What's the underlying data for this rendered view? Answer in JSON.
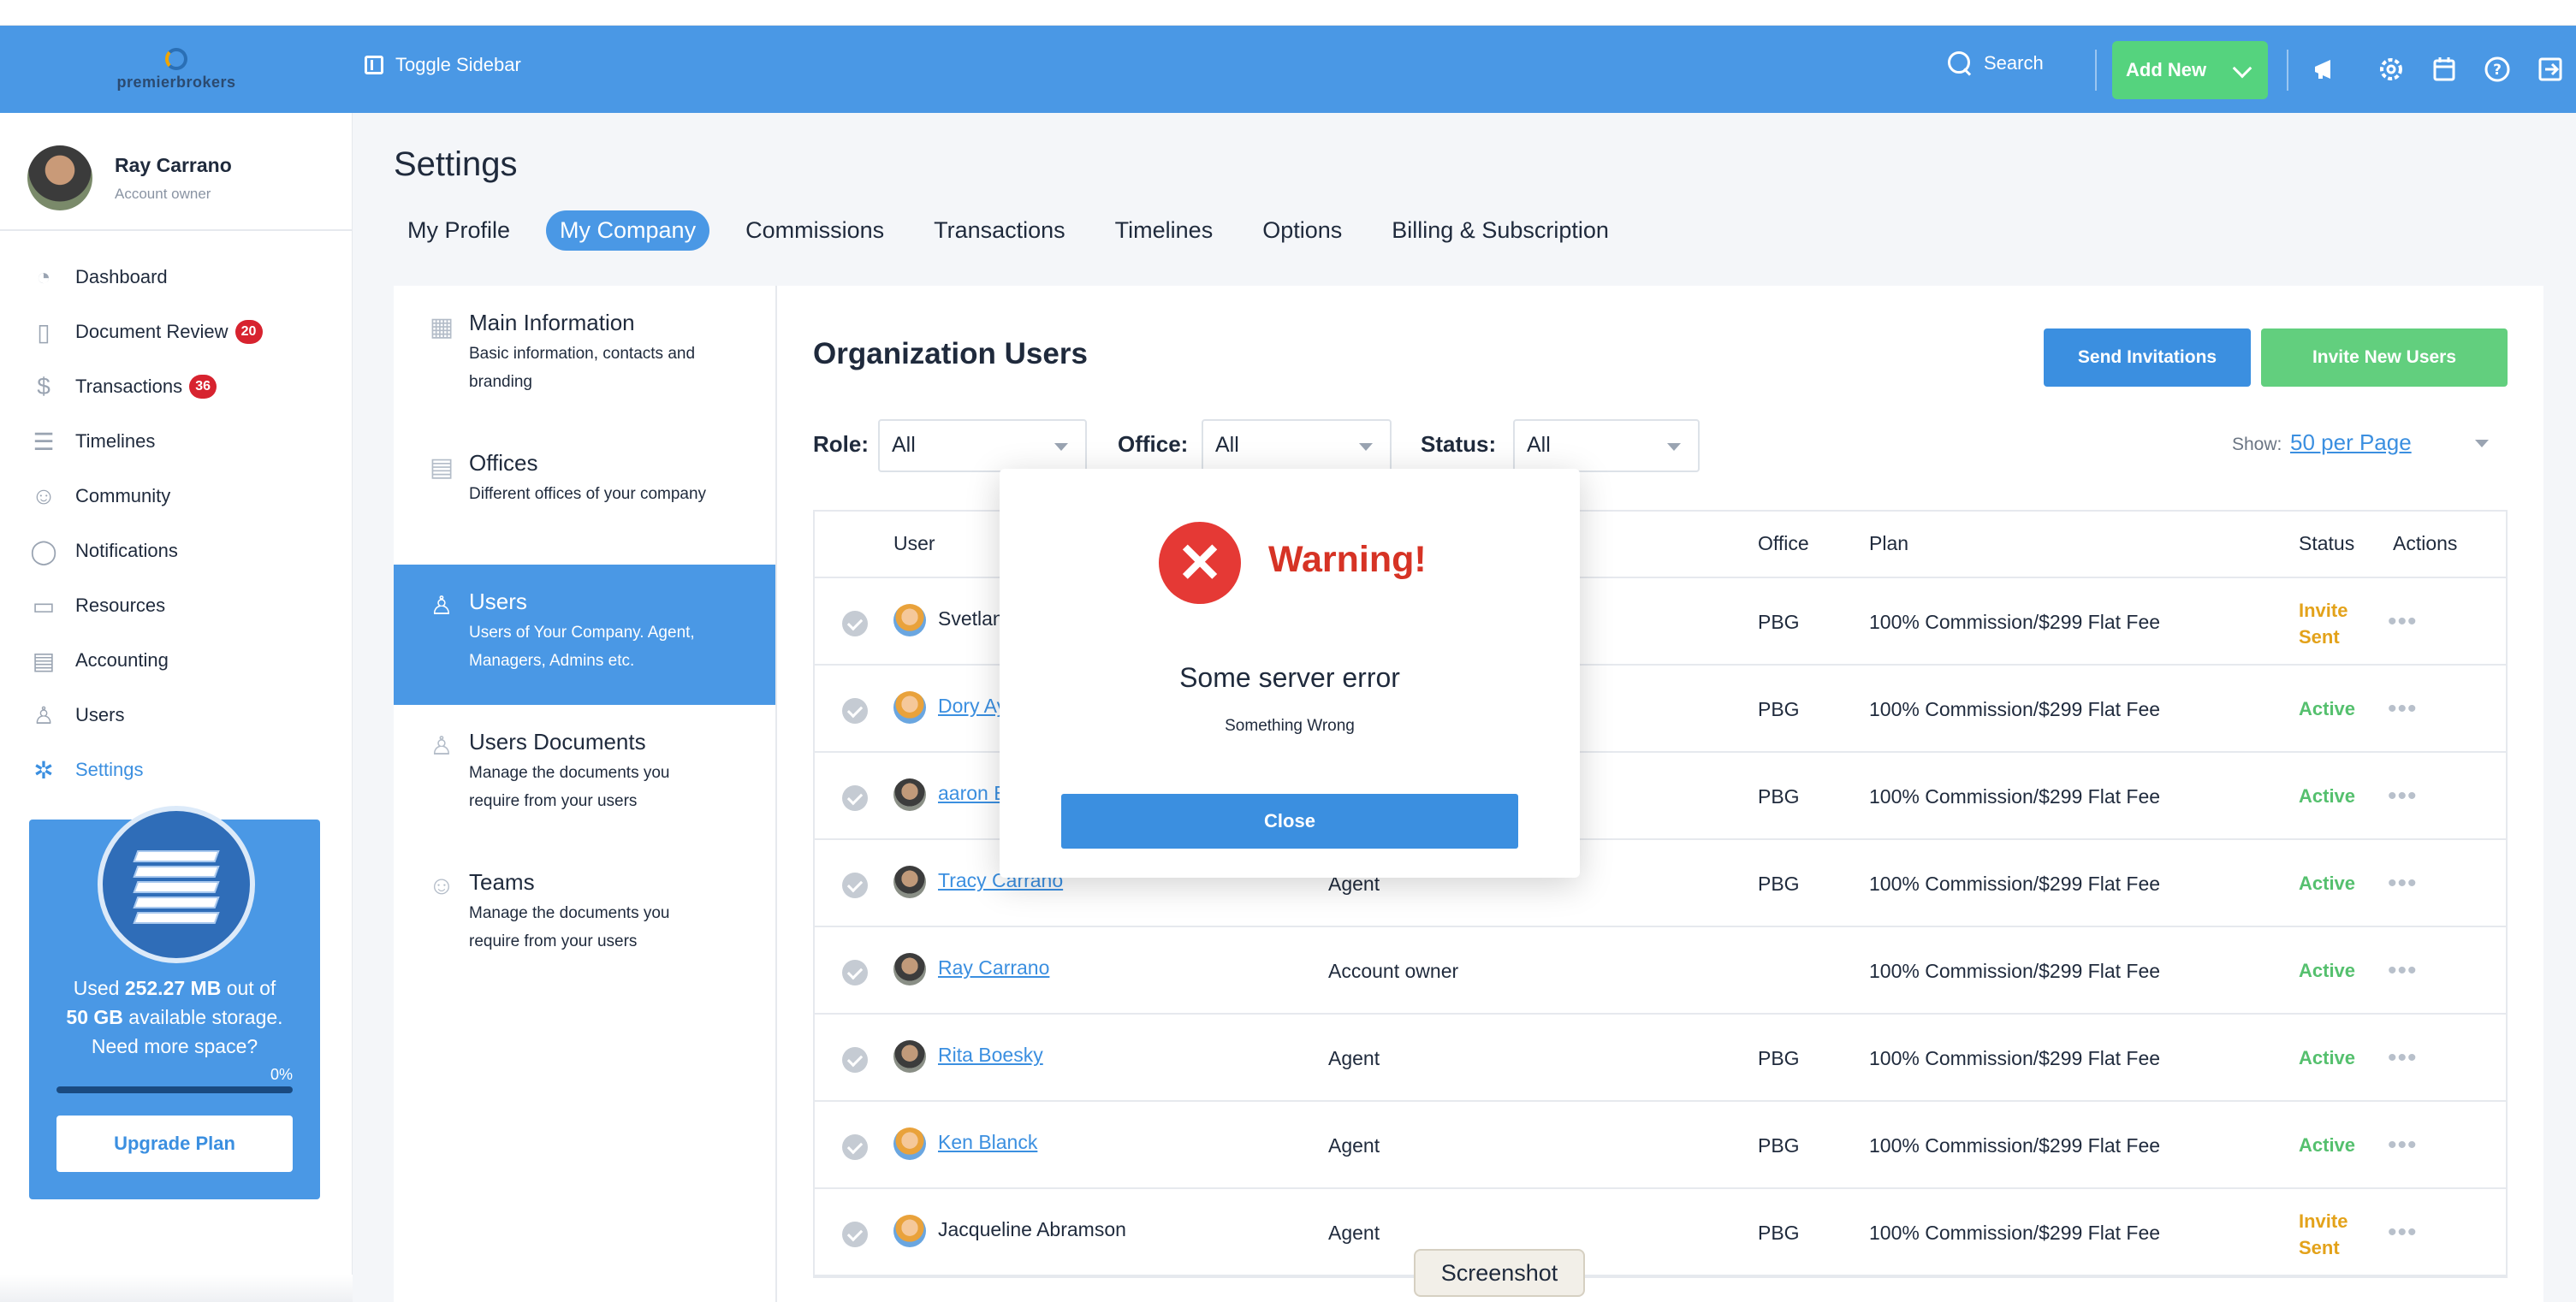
{
  "logo": {
    "text": "premierbrokers"
  },
  "topbar": {
    "toggle_label": "Toggle Sidebar",
    "search_label": "Search",
    "add_new_label": "Add New",
    "icons": [
      "megaphone-icon",
      "gear-icon",
      "calendar-icon",
      "help-icon",
      "logout-icon"
    ]
  },
  "profile": {
    "name": "Ray Carrano",
    "role": "Account owner"
  },
  "sidebar": {
    "items": [
      {
        "label": "Dashboard",
        "icon": "gauge-icon",
        "badge": ""
      },
      {
        "label": "Document Review",
        "icon": "document-icon",
        "badge": "20"
      },
      {
        "label": "Transactions",
        "icon": "dollar-icon",
        "badge": "36"
      },
      {
        "label": "Timelines",
        "icon": "timeline-icon",
        "badge": ""
      },
      {
        "label": "Community",
        "icon": "people-icon",
        "badge": ""
      },
      {
        "label": "Notifications",
        "icon": "chat-icon",
        "badge": ""
      },
      {
        "label": "Resources",
        "icon": "folder-icon",
        "badge": ""
      },
      {
        "label": "Accounting",
        "icon": "ledger-icon",
        "badge": ""
      },
      {
        "label": "Users",
        "icon": "user-icon",
        "badge": ""
      },
      {
        "label": "Settings",
        "icon": "gear-icon",
        "badge": ""
      }
    ]
  },
  "storage": {
    "line1_pre": "Used ",
    "used": "252.27 MB",
    "line1_post": " out of",
    "total": "50 GB",
    "line2_post": " available storage.",
    "line3": "Need more space?",
    "percent_label": "0%",
    "percent_value": 0,
    "upgrade_label": "Upgrade Plan"
  },
  "page": {
    "title": "Settings"
  },
  "tabs": [
    "My Profile",
    "My Company",
    "Commissions",
    "Transactions",
    "Timelines",
    "Options",
    "Billing & Subscription"
  ],
  "settings_menu": [
    {
      "title": "Main Information",
      "desc1": "Basic information, contacts and",
      "desc2": "branding"
    },
    {
      "title": "Offices",
      "desc1": "Different offices of your company",
      "desc2": ""
    },
    {
      "title": "Users",
      "desc1": "Users of Your Company. Agent,",
      "desc2": "Managers, Admins etc."
    },
    {
      "title": "Users Documents",
      "desc1": "Manage the documents you",
      "desc2": "require from your users"
    },
    {
      "title": "Teams",
      "desc1": "Manage the documents you",
      "desc2": "require from your users"
    }
  ],
  "org": {
    "title": "Organization Users",
    "send_label": "Send Invitations",
    "invite_label": "Invite New Users",
    "filters": {
      "role_label": "Role:",
      "role_value": "All",
      "office_label": "Office:",
      "office_value": "All",
      "status_label": "Status:",
      "status_value": "All"
    },
    "show_label": "Show:",
    "show_value": "50 per Page",
    "columns": [
      "User",
      "Office",
      "Plan",
      "Status",
      "Actions"
    ],
    "rows": [
      {
        "user": "Svetlan",
        "link": false,
        "role": "",
        "office": "PBG",
        "plan": "100% Commission/$299 Flat Fee",
        "status1": "Invite",
        "status2": "Sent",
        "photo": false
      },
      {
        "user": "Dory Ay",
        "link": true,
        "role": "",
        "office": "PBG",
        "plan": "100% Commission/$299 Flat Fee",
        "status1": "Active",
        "status2": "",
        "photo": false
      },
      {
        "user": "aaron E",
        "link": true,
        "role": "",
        "office": "PBG",
        "plan": "100% Commission/$299 Flat Fee",
        "status1": "Active",
        "status2": "",
        "photo": true
      },
      {
        "user": "Tracy Carrano",
        "link": true,
        "role": "Agent",
        "office": "PBG",
        "plan": "100% Commission/$299 Flat Fee",
        "status1": "Active",
        "status2": "",
        "photo": true
      },
      {
        "user": "Ray Carrano",
        "link": true,
        "role": "Account owner",
        "office": "",
        "plan": "100% Commission/$299 Flat Fee",
        "status1": "Active",
        "status2": "",
        "photo": true
      },
      {
        "user": "Rita Boesky",
        "link": true,
        "role": "Agent",
        "office": "PBG",
        "plan": "100% Commission/$299 Flat Fee",
        "status1": "Active",
        "status2": "",
        "photo": true
      },
      {
        "user": "Ken Blanck",
        "link": true,
        "role": "Agent",
        "office": "PBG",
        "plan": "100% Commission/$299 Flat Fee",
        "status1": "Active",
        "status2": "",
        "photo": false
      },
      {
        "user": "Jacqueline Abramson",
        "link": false,
        "role": "Agent",
        "office": "PBG",
        "plan": "100% Commission/$299 Flat Fee",
        "status1": "Invite",
        "status2": "Sent",
        "photo": false
      }
    ],
    "actions_glyph": "•••"
  },
  "modal": {
    "title": "Warning!",
    "message": "Some server error",
    "sub": "Something Wrong",
    "close_label": "Close"
  },
  "tooltip": {
    "label": "Screenshot"
  },
  "colors": {
    "primary": "#4a98e5",
    "success": "#55d37e",
    "danger": "#e53935",
    "warning": "#e3a21a"
  }
}
